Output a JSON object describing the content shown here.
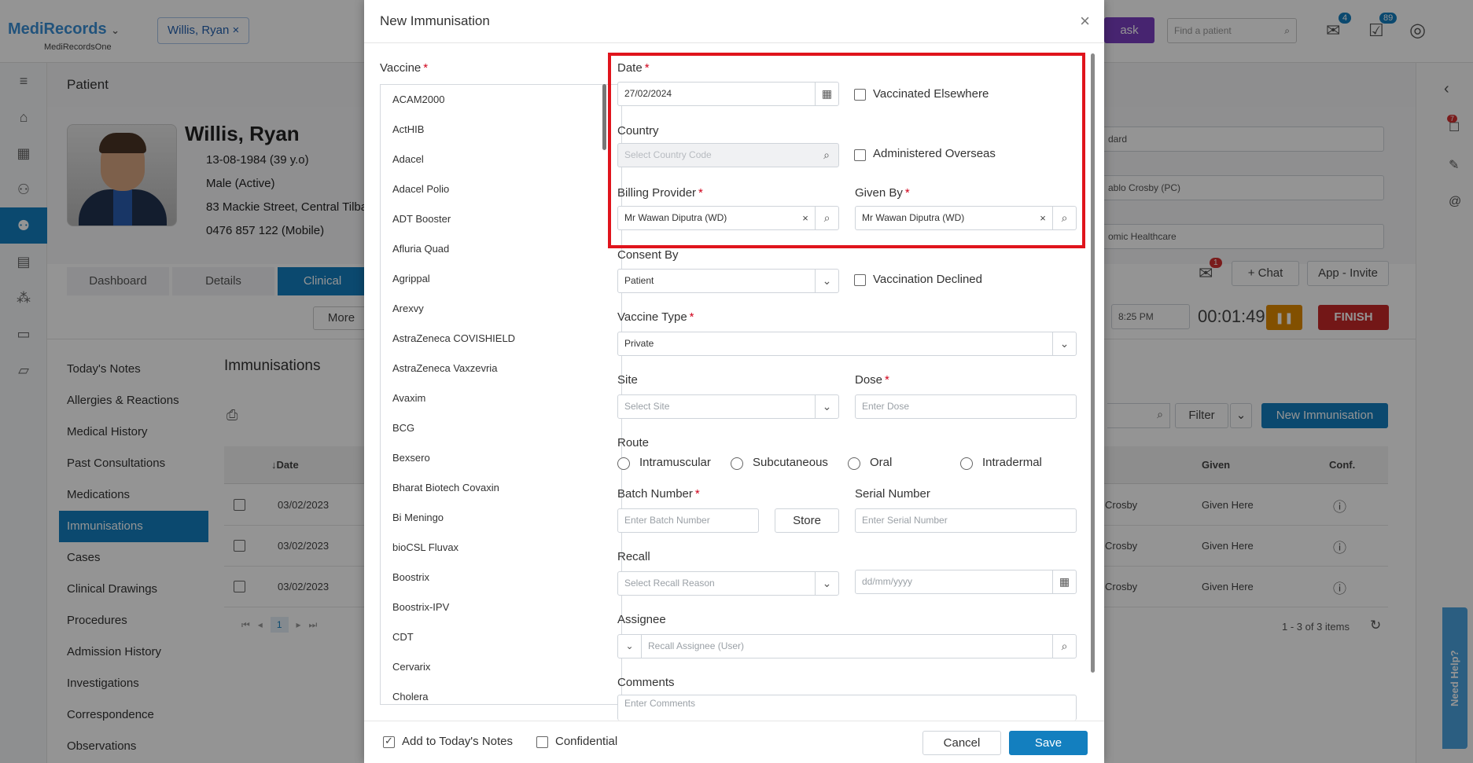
{
  "app": {
    "logo": "MediRecords",
    "logo_sub": "MediRecordsOne",
    "patient_chip": "Willis, Ryan",
    "find_patient_placeholder": "Find a patient",
    "mail_badge": "4",
    "tasks_badge": "89",
    "task_button_fragment": "ask"
  },
  "patient": {
    "section_title": "Patient",
    "name": "Willis, Ryan",
    "dob": "13-08-1984 (39 y.o)",
    "gender": "Male (Active)",
    "address": "83 Mackie Street, Central Tilba",
    "phone": "0476 857 122 (Mobile)",
    "tabs": [
      "Dashboard",
      "Details",
      "Clinical"
    ],
    "toolbar_more": "More",
    "menu": [
      "Today's Notes",
      "Allergies & Reactions",
      "Medical History",
      "Past Consultations",
      "Medications",
      "Immunisations",
      "Cases",
      "Clinical Drawings",
      "Procedures",
      "Admission History",
      "Investigations",
      "Correspondence",
      "Observations"
    ],
    "active_menu": "Immunisations",
    "immunisations_title": "Immunisations",
    "table_headers": {
      "date": "↓Date",
      "given": "Given",
      "conf": "Conf."
    },
    "rows": [
      {
        "date": "03/02/2023",
        "by": "Crosby",
        "given": "Given Here"
      },
      {
        "date": "03/02/2023",
        "by": "Crosby",
        "given": "Given Here"
      },
      {
        "date": "03/02/2023",
        "by": "Crosby",
        "given": "Given Here"
      }
    ],
    "pager_page": "1",
    "items_label": "1 - 3 of 3 items",
    "filter_label": "Filter",
    "new_immunisation_label": "New Immunisation",
    "right_selects": [
      "dard",
      "ablo Crosby (PC)",
      "omic Healthcare"
    ],
    "chat_label": "Chat",
    "chat_badge": "1",
    "app_invite_label": "App - Invite",
    "time_value": "8:25 PM",
    "timer": "00:01:49",
    "finish_label": "FINISH",
    "need_help": "Need Help?",
    "right_rail_badge": "7"
  },
  "modal": {
    "title": "New Immunisation",
    "vaccine_label": "Vaccine",
    "vaccines": [
      "ACAM2000",
      "ActHIB",
      "Adacel",
      "Adacel Polio",
      "ADT Booster",
      "Afluria Quad",
      "Agrippal",
      "Arexvy",
      "AstraZeneca COVISHIELD",
      "AstraZeneca Vaxzevria",
      "Avaxim",
      "BCG",
      "Bexsero",
      "Bharat Biotech Covaxin",
      "Bi Meningo",
      "bioCSL Fluvax",
      "Boostrix",
      "Boostrix-IPV",
      "CDT",
      "Cervarix",
      "Cholera"
    ],
    "date_label": "Date",
    "date_value": "27/02/2024",
    "vaccinated_elsewhere": "Vaccinated Elsewhere",
    "country_label": "Country",
    "country_placeholder": "Select Country Code",
    "administered_overseas": "Administered Overseas",
    "billing_provider_label": "Billing Provider",
    "billing_provider_value": "Mr Wawan Diputra (WD)",
    "given_by_label": "Given By",
    "given_by_value": "Mr Wawan Diputra (WD)",
    "consent_by_label": "Consent By",
    "consent_by_value": "Patient",
    "vaccination_declined": "Vaccination Declined",
    "vaccine_type_label": "Vaccine Type",
    "vaccine_type_value": "Private",
    "site_label": "Site",
    "site_placeholder": "Select Site",
    "dose_label": "Dose",
    "dose_placeholder": "Enter Dose",
    "route_label": "Route",
    "routes": [
      "Intramuscular",
      "Subcutaneous",
      "Oral",
      "Intradermal"
    ],
    "batch_label": "Batch Number",
    "batch_placeholder": "Enter Batch Number",
    "store_label": "Store",
    "serial_label": "Serial Number",
    "serial_placeholder": "Enter Serial Number",
    "recall_label": "Recall",
    "recall_placeholder": "Select Recall Reason",
    "recall_date_placeholder": "dd/mm/yyyy",
    "assignee_label": "Assignee",
    "assignee_placeholder": "Recall Assignee (User)",
    "comments_label": "Comments",
    "comments_placeholder": "Enter Comments",
    "add_to_notes": "Add to Today's Notes",
    "confidential": "Confidential",
    "cancel_label": "Cancel",
    "save_label": "Save"
  },
  "colors": {
    "primary": "#137fbf",
    "highlight": "#e0141c",
    "required": "#d0021b",
    "finish": "#c62828",
    "pause": "#e08a00"
  }
}
